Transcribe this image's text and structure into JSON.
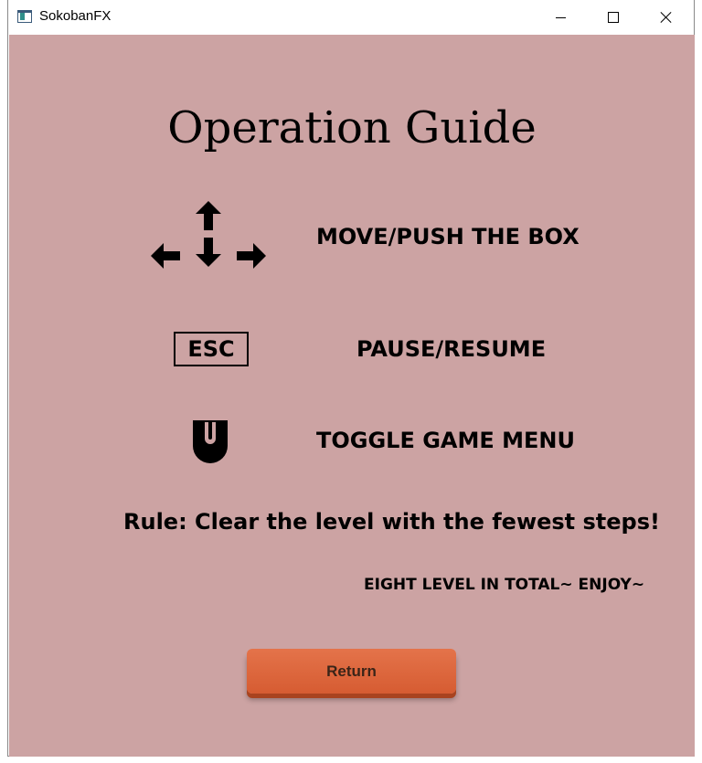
{
  "window": {
    "title": "SokobanFX",
    "app_icon": "window-app-icon",
    "controls": [
      "minimize-icon",
      "maximize-icon",
      "close-icon"
    ]
  },
  "guide": {
    "heading": "Operation Guide",
    "items": [
      {
        "icon": "arrow-keys-icon",
        "label": "MOVE/PUSH THE BOX"
      },
      {
        "icon": "esc-key-icon",
        "key_text": "ESC",
        "label": "PAUSE/RESUME"
      },
      {
        "icon": "mouse-right-click-icon",
        "label": "TOGGLE GAME MENU"
      }
    ],
    "rule": "Rule: Clear the level with the fewest steps!",
    "footer_note": "EIGHT LEVEL IN TOTAL~ ENJOY~"
  },
  "buttons": {
    "return_label": "Return"
  },
  "colors": {
    "background": "#cca3a3",
    "button": "#de6a3f",
    "text": "#000000"
  }
}
